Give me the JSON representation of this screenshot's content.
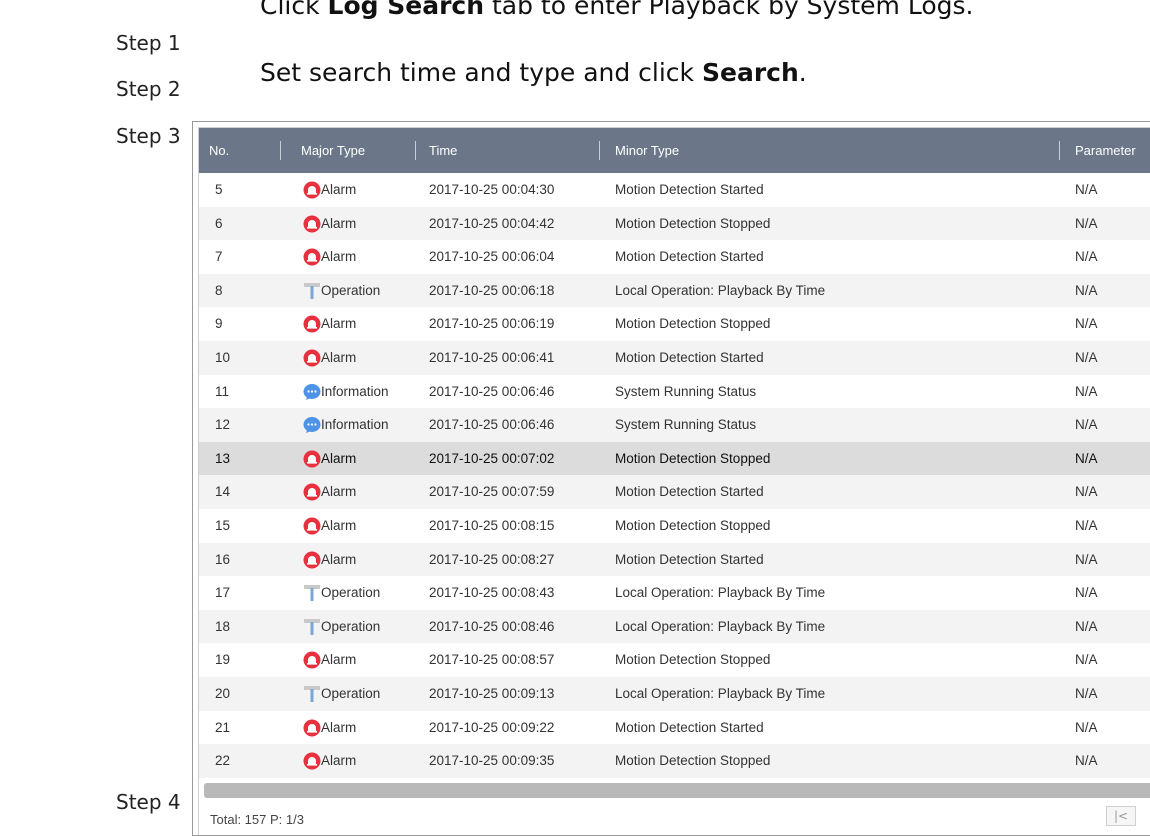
{
  "steps": [
    "Step 1",
    "Step 2",
    "Step 3",
    "Step 4"
  ],
  "instructions": {
    "line1": {
      "pre": "Click ",
      "bold": "Log Search",
      "post": " tab to enter Playback by System Logs."
    },
    "line2": {
      "pre": "Set search time and type and click ",
      "bold": "Search",
      "post": "."
    }
  },
  "table": {
    "columns": [
      "No.",
      "Major Type",
      "Time",
      "Minor Type",
      "Parameter"
    ],
    "rows": [
      {
        "no": "5",
        "type": "Alarm",
        "icon": "alarm-icon",
        "time": "2017-10-25 00:04:30",
        "minor": "Motion Detection Started",
        "param": "N/A"
      },
      {
        "no": "6",
        "type": "Alarm",
        "icon": "alarm-icon",
        "time": "2017-10-25 00:04:42",
        "minor": "Motion Detection Stopped",
        "param": "N/A"
      },
      {
        "no": "7",
        "type": "Alarm",
        "icon": "alarm-icon",
        "time": "2017-10-25 00:06:04",
        "minor": "Motion Detection Started",
        "param": "N/A"
      },
      {
        "no": "8",
        "type": "Operation",
        "icon": "operation-icon",
        "time": "2017-10-25 00:06:18",
        "minor": "Local Operation: Playback By Time",
        "param": "N/A"
      },
      {
        "no": "9",
        "type": "Alarm",
        "icon": "alarm-icon",
        "time": "2017-10-25 00:06:19",
        "minor": "Motion Detection Stopped",
        "param": "N/A"
      },
      {
        "no": "10",
        "type": "Alarm",
        "icon": "alarm-icon",
        "time": "2017-10-25 00:06:41",
        "minor": "Motion Detection Started",
        "param": "N/A"
      },
      {
        "no": "11",
        "type": "Information",
        "icon": "information-icon",
        "time": "2017-10-25 00:06:46",
        "minor": "System Running Status",
        "param": "N/A"
      },
      {
        "no": "12",
        "type": "Information",
        "icon": "information-icon",
        "time": "2017-10-25 00:06:46",
        "minor": "System Running Status",
        "param": "N/A"
      },
      {
        "no": "13",
        "type": "Alarm",
        "icon": "alarm-icon",
        "time": "2017-10-25 00:07:02",
        "minor": "Motion Detection Stopped",
        "param": "N/A",
        "selected": true
      },
      {
        "no": "14",
        "type": "Alarm",
        "icon": "alarm-icon",
        "time": "2017-10-25 00:07:59",
        "minor": "Motion Detection Started",
        "param": "N/A"
      },
      {
        "no": "15",
        "type": "Alarm",
        "icon": "alarm-icon",
        "time": "2017-10-25 00:08:15",
        "minor": "Motion Detection Stopped",
        "param": "N/A"
      },
      {
        "no": "16",
        "type": "Alarm",
        "icon": "alarm-icon",
        "time": "2017-10-25 00:08:27",
        "minor": "Motion Detection Started",
        "param": "N/A"
      },
      {
        "no": "17",
        "type": "Operation",
        "icon": "operation-icon",
        "time": "2017-10-25 00:08:43",
        "minor": "Local Operation: Playback By Time",
        "param": "N/A"
      },
      {
        "no": "18",
        "type": "Operation",
        "icon": "operation-icon",
        "time": "2017-10-25 00:08:46",
        "minor": "Local Operation: Playback By Time",
        "param": "N/A"
      },
      {
        "no": "19",
        "type": "Alarm",
        "icon": "alarm-icon",
        "time": "2017-10-25 00:08:57",
        "minor": "Motion Detection Stopped",
        "param": "N/A"
      },
      {
        "no": "20",
        "type": "Operation",
        "icon": "operation-icon",
        "time": "2017-10-25 00:09:13",
        "minor": "Local Operation: Playback By Time",
        "param": "N/A"
      },
      {
        "no": "21",
        "type": "Alarm",
        "icon": "alarm-icon",
        "time": "2017-10-25 00:09:22",
        "minor": "Motion Detection Started",
        "param": "N/A"
      },
      {
        "no": "22",
        "type": "Alarm",
        "icon": "alarm-icon",
        "time": "2017-10-25 00:09:35",
        "minor": "Motion Detection Stopped",
        "param": "N/A"
      }
    ]
  },
  "footer": {
    "total": "Total: 157  P: 1/3"
  },
  "colors": {
    "header_bg": "#6b7789",
    "alarm": "#e8313f",
    "info": "#4d94e8",
    "operation": "#7aa7d6"
  }
}
